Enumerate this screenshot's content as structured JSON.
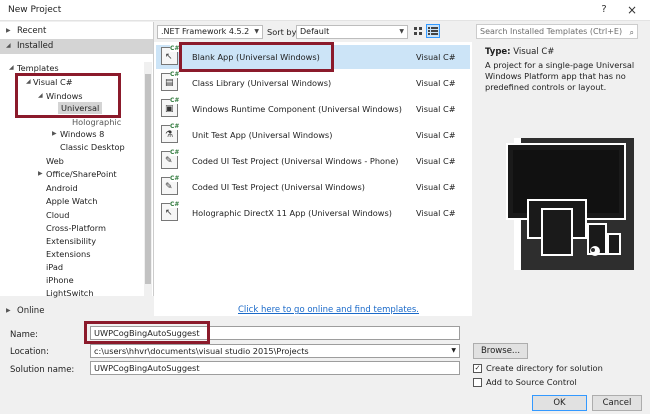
{
  "window": {
    "title": "New Project",
    "help": "?",
    "close": "×"
  },
  "left": {
    "recent": "Recent",
    "installed": "Installed",
    "templates": "Templates",
    "visual_csharp": "Visual C#",
    "windows": "Windows",
    "universal": "Universal",
    "holographic": "Holographic",
    "windows8": "Windows 8",
    "classic": "Classic Desktop",
    "web": "Web",
    "office": "Office/SharePoint",
    "android": "Android",
    "applewatch": "Apple Watch",
    "cloud": "Cloud",
    "crossplatform": "Cross-Platform",
    "extensibility": "Extensibility",
    "extensions": "Extensions",
    "ipad": "iPad",
    "iphone": "iPhone",
    "lightswitch": "LightSwitch",
    "online": "Online"
  },
  "toolbar": {
    "framework": ".NET Framework 4.5.2",
    "sortby_label": "Sort by:",
    "sortby_value": "Default",
    "search_placeholder": "Search Installed Templates (Ctrl+E)"
  },
  "templates": [
    {
      "name": "Blank App (Universal Windows)",
      "lang": "Visual C#"
    },
    {
      "name": "Class Library (Universal Windows)",
      "lang": "Visual C#"
    },
    {
      "name": "Windows Runtime Component (Universal Windows)",
      "lang": "Visual C#"
    },
    {
      "name": "Unit Test App (Universal Windows)",
      "lang": "Visual C#"
    },
    {
      "name": "Coded UI Test Project (Universal Windows - Phone)",
      "lang": "Visual C#"
    },
    {
      "name": "Coded UI Test Project (Universal Windows)",
      "lang": "Visual C#"
    },
    {
      "name": "Holographic DirectX 11 App (Universal Windows)",
      "lang": "Visual C#"
    }
  ],
  "online_link": "Click here to go online and find templates.",
  "details": {
    "type_label": "Type:",
    "type_value": "Visual C#",
    "description": "A project for a single-page Universal Windows Platform app that has no predefined controls or layout."
  },
  "form": {
    "name_label": "Name:",
    "name_value": "UWPCogBingAutoSuggest",
    "location_label": "Location:",
    "location_value": "c:\\users\\hhvr\\documents\\visual studio 2015\\Projects",
    "solution_label": "Solution name:",
    "solution_value": "UWPCogBingAutoSuggest",
    "browse": "Browse...",
    "create_dir": "Create directory for solution",
    "add_source": "Add to Source Control",
    "create_dir_checked": true,
    "add_source_checked": false,
    "ok": "OK",
    "cancel": "Cancel"
  },
  "colors": {
    "highlight": "#8b1a2b",
    "link": "#1b6ac9",
    "selection": "#cce4f7"
  }
}
